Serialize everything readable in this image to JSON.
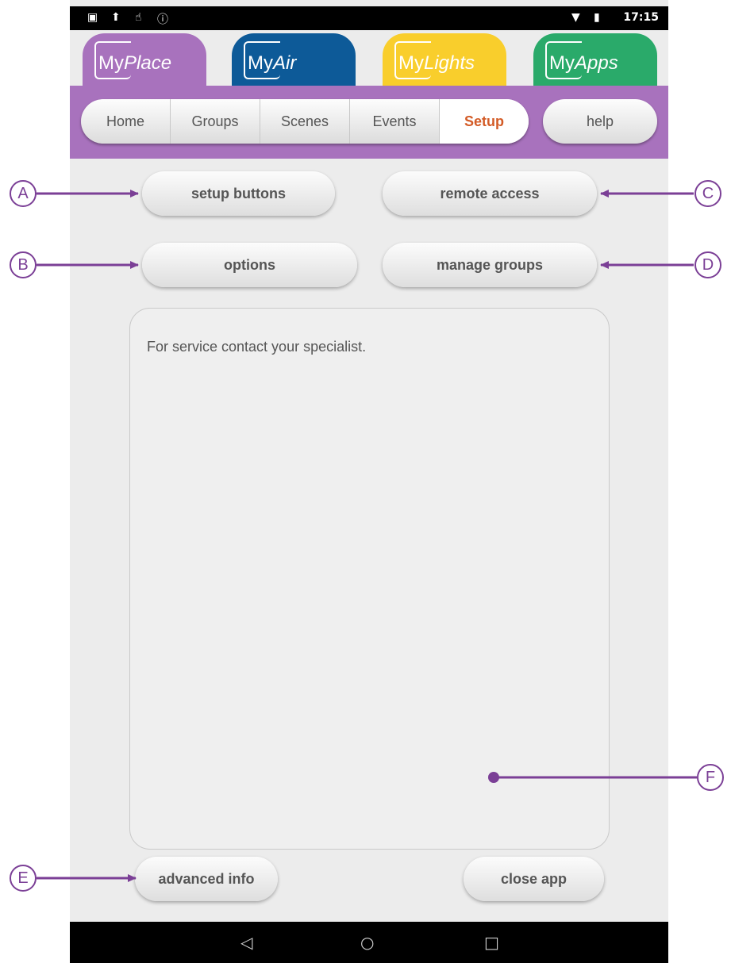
{
  "status_bar": {
    "left_icons": [
      "sim-icon",
      "upload-icon",
      "touch-icon",
      "info-icon"
    ],
    "left_glyphs": [
      "▣",
      "⬆",
      "☝",
      "ⓘ"
    ],
    "time": "17:15",
    "wifi_glyph": "▼",
    "battery_glyph": "▮"
  },
  "app_tabs": [
    {
      "prefix": "My",
      "suffix": "Place",
      "color": "#a872bd"
    },
    {
      "prefix": "My",
      "suffix": "Air",
      "color": "#0d5a98"
    },
    {
      "prefix": "My",
      "suffix": "Lights",
      "color": "#f9ce2c"
    },
    {
      "prefix": "My",
      "suffix": "Apps",
      "color": "#2aaa6a"
    }
  ],
  "nav": {
    "items": [
      "Home",
      "Groups",
      "Scenes",
      "Events",
      "Setup"
    ],
    "active": "Setup",
    "help_label": "help"
  },
  "setup": {
    "setup_buttons_label": "setup buttons",
    "remote_access_label": "remote access",
    "options_label": "options",
    "manage_groups_label": "manage groups",
    "info_text": "For service contact your specialist.",
    "advanced_info_label": "advanced info",
    "close_app_label": "close app"
  },
  "callouts": {
    "a": "A",
    "b": "B",
    "c": "C",
    "d": "D",
    "e": "E",
    "f": "F"
  },
  "system_nav": {
    "back_glyph": "◁",
    "home_glyph": "○",
    "recents_glyph": "□"
  },
  "colors": {
    "accent_purple": "#7b3f96",
    "active_tab_text": "#d35b26"
  }
}
